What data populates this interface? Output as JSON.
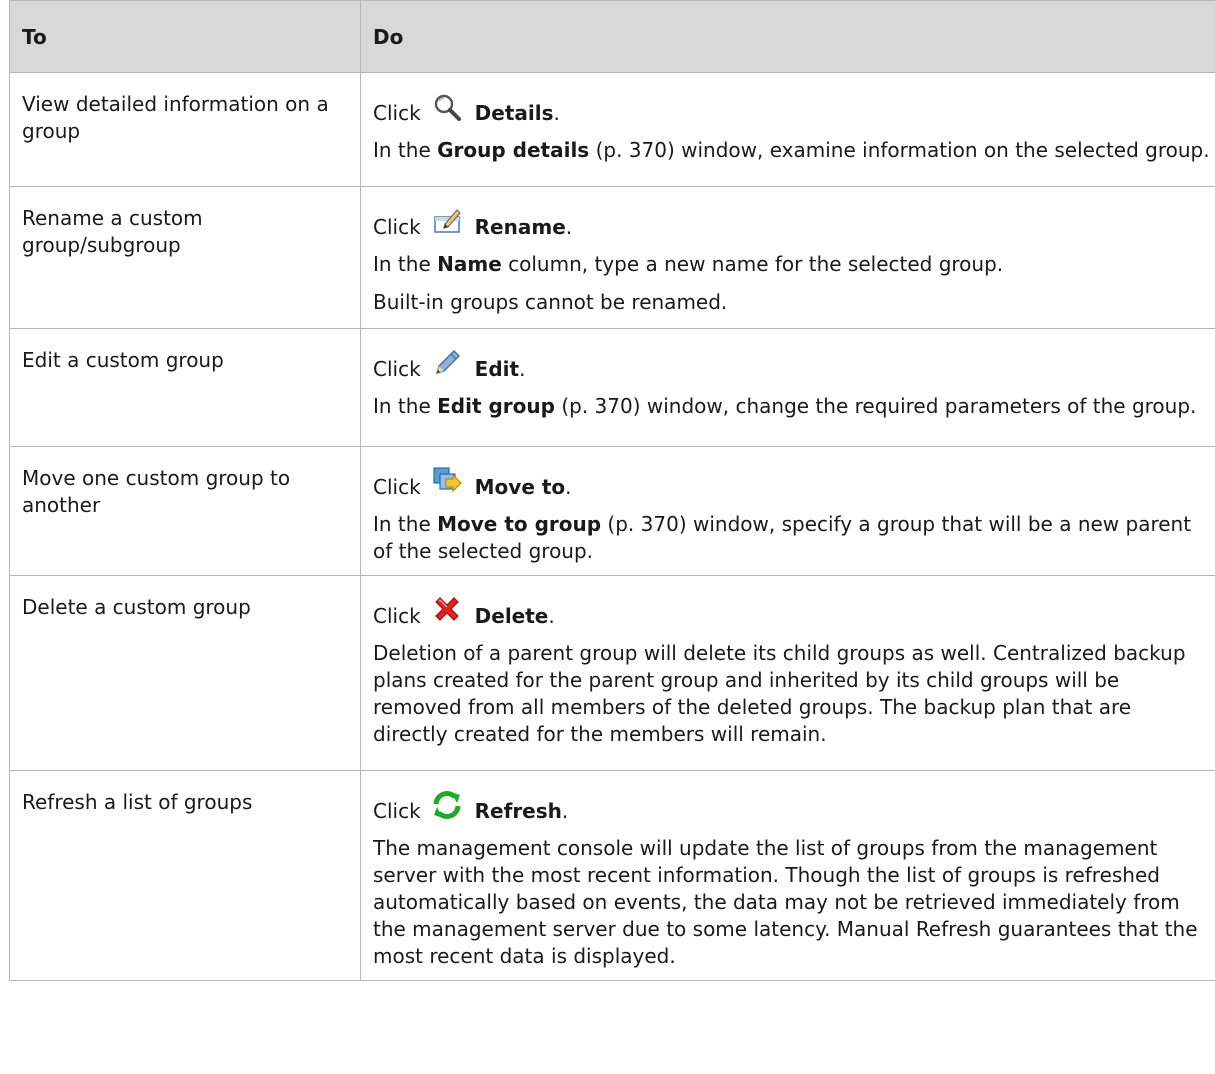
{
  "header": {
    "col_to": "To",
    "col_do": "Do"
  },
  "rows": [
    {
      "to": "View detailed information on a group",
      "click_word": "Click",
      "icon": "magnifier-icon",
      "command": "Details",
      "end": ".",
      "desc1": {
        "pre": "In the ",
        "bold": "Group details",
        "post": " (p. 370) window, examine information on the selected group."
      }
    },
    {
      "to": "Rename a custom group/subgroup",
      "click_word": "Click",
      "icon": "rename-icon",
      "command": "Rename",
      "end": ".",
      "desc1": {
        "pre": "In the ",
        "bold": "Name",
        "post": " column, type a new name for the selected group."
      },
      "desc2": "Built-in groups cannot be renamed."
    },
    {
      "to": "Edit a custom group",
      "click_word": "Click",
      "icon": "pencil-icon",
      "command": "Edit",
      "end": ".",
      "desc1": {
        "pre": "In the ",
        "bold": "Edit group",
        "post": " (p. 370) window, change the required parameters of the group."
      }
    },
    {
      "to": "Move one custom group to another",
      "click_word": "Click",
      "icon": "move-icon",
      "command": "Move to",
      "end": ".",
      "desc1": {
        "pre": "In the ",
        "bold": "Move to group",
        "post": " (p. 370) window, specify a group that will be a new parent of the selected group."
      }
    },
    {
      "to": "Delete a custom group",
      "click_word": "Click",
      "icon": "delete-icon",
      "command": "Delete",
      "end": ".",
      "desc1": "Deletion of a parent group will delete its child groups as well. Centralized backup plans created for the parent group and inherited by its child groups will be removed from all members of the deleted groups. The backup plan that are directly created for the members will remain."
    },
    {
      "to": "Refresh a list of groups",
      "click_word": "Click",
      "icon": "refresh-icon",
      "command": "Refresh",
      "end": ".",
      "desc1": "The management console will update the list of groups from the management server with the most recent information. Though the list of groups is refreshed automatically based on events, the data may not be retrieved immediately from the management server due to some latency. Manual Refresh guarantees that the most recent data is displayed."
    }
  ],
  "colors": {
    "header_bg": "#d8d8d8",
    "border": "#b7b7b7",
    "delete_red": "#e0231f",
    "refresh_green": "#22a82b"
  }
}
